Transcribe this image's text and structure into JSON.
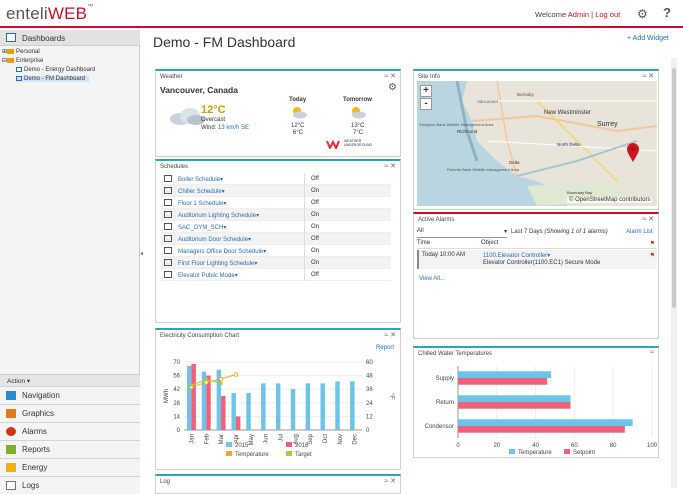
{
  "header": {
    "logo_prefix": "enteli",
    "logo_main": "WEB",
    "logo_tm": "™",
    "welcome": "Welcome",
    "user": "Admin",
    "separator": "|",
    "logout": "Log out",
    "gear_icon": "gear-icon",
    "help": "?"
  },
  "sidebar": {
    "dashboards_label": "Dashboards",
    "tree": [
      {
        "label": "Personal"
      },
      {
        "label": "Enterprise"
      },
      {
        "label": "Demo - Energy Dashboard"
      },
      {
        "label": "Demo - FM Dashboard"
      }
    ],
    "action_label": "Action",
    "nav": [
      {
        "label": "Navigation",
        "color": "#2a8cd0"
      },
      {
        "label": "Graphics",
        "color": "#e07a1a"
      },
      {
        "label": "Alarms",
        "color": "#d0321a"
      },
      {
        "label": "Reports",
        "color": "#7ab02a"
      },
      {
        "label": "Energy",
        "color": "#f0b010"
      },
      {
        "label": "Logs",
        "color": "#777777"
      }
    ]
  },
  "main": {
    "title": "Demo - FM Dashboard",
    "add_widget": "+ Add Widget"
  },
  "weather": {
    "title": "Weather",
    "city": "Vancouver, Canada",
    "temp": "12°C",
    "condition": "Overcast",
    "wind_label": "Wind:",
    "wind_value": "13 km/h SE",
    "today_label": "Today",
    "today_hi": "12°C",
    "today_lo": "6°C",
    "tomorrow_label": "Tomorrow",
    "tomorrow_hi": "13°C",
    "tomorrow_lo": "7°C",
    "brand_line1": "WEATHER",
    "brand_line2": "UNDERGROUND"
  },
  "schedules": {
    "title": "Schedules",
    "rows": [
      {
        "name": "Boiler Schedule",
        "state": "Off"
      },
      {
        "name": "Chiller Schedule",
        "state": "On"
      },
      {
        "name": "Floor 1 Schedule",
        "state": "Off"
      },
      {
        "name": "Auditorium Lighting Schedule",
        "state": "On"
      },
      {
        "name": "SAC_GYM_SCH",
        "state": "On"
      },
      {
        "name": "Auditorium Door Schedule",
        "state": "Off"
      },
      {
        "name": "Managers Office Door Schedule",
        "state": "On"
      },
      {
        "name": "First Floor Lighting Schedule",
        "state": "On"
      },
      {
        "name": "Elevator Public Mode",
        "state": "Off"
      }
    ]
  },
  "site_info": {
    "title": "Site Info",
    "zoom_in": "+",
    "zoom_out": "-",
    "attribution": "© OpenStreetMap contributors",
    "places": [
      "Vancouver",
      "New Westminster",
      "Surrey",
      "Burnaby",
      "Richmond",
      "Sturgeon Bank Wildlife Management Area",
      "North Delta",
      "Roberts Bank Wildlife Management Area",
      "Delta",
      "Boundary Bay"
    ]
  },
  "alarms": {
    "title": "Active Alarms",
    "filter_value": "All",
    "range": "Last 7 Days",
    "summary": "(Showing 1 of 1 alarms)",
    "alarm_list": "Alarm List",
    "col_time": "Time",
    "col_object": "Object",
    "row_time": "Today 10:00 AM",
    "row_object": "1100.Elevator Controller",
    "row_desc": "Elevator Controller(1100.EC1) Secure Mode",
    "view_all": "View All..."
  },
  "electricity": {
    "title": "Electricity Consumption Chart",
    "report": "Report"
  },
  "chilled": {
    "title": "Chilled Water Temperatures"
  },
  "log": {
    "title": "Log"
  },
  "chart_data": [
    {
      "type": "bar",
      "title": "",
      "categories": [
        "Jan",
        "Feb",
        "Mar",
        "Apr",
        "May",
        "Jun",
        "Jul",
        "Aug",
        "Sep",
        "Oct",
        "Nov",
        "Dec"
      ],
      "ylabel": "MWh",
      "y2label": "°F",
      "ylim": [
        0,
        70
      ],
      "y2lim": [
        0,
        60
      ],
      "yticks": [
        0,
        14,
        28,
        42,
        56,
        70
      ],
      "y2ticks": [
        0,
        12,
        24,
        36,
        48,
        60
      ],
      "series": [
        {
          "name": "2015",
          "kind": "bar",
          "color": "#6cc4e8",
          "values": [
            66,
            60,
            62,
            38,
            38,
            48,
            48,
            42,
            48,
            48,
            50,
            50
          ]
        },
        {
          "name": "2016",
          "kind": "bar",
          "color": "#f0607a",
          "values": [
            68,
            56,
            35,
            14,
            null,
            null,
            null,
            null,
            null,
            null,
            null,
            null
          ]
        },
        {
          "name": "Temperature",
          "kind": "line",
          "axis": "y2",
          "color": "#f5a623",
          "values": [
            38,
            42,
            45,
            49,
            null,
            null,
            null,
            null,
            null,
            null,
            null,
            null
          ]
        },
        {
          "name": "Target",
          "kind": "line",
          "color": "#a8cf3a",
          "values": [
            46,
            52,
            48,
            null,
            null,
            null,
            null,
            null,
            null,
            null,
            null,
            null
          ]
        }
      ]
    },
    {
      "type": "bar",
      "orientation": "horizontal",
      "title": "",
      "categories": [
        "Supply",
        "Return",
        "Condensor"
      ],
      "xlim": [
        0,
        100
      ],
      "xticks": [
        0,
        20,
        40,
        60,
        80,
        100
      ],
      "series": [
        {
          "name": "Temperature",
          "color": "#6cc4e8",
          "values": [
            48,
            58,
            90
          ]
        },
        {
          "name": "Setpoint",
          "color": "#f0607a",
          "values": [
            46,
            58,
            86
          ]
        }
      ]
    }
  ]
}
